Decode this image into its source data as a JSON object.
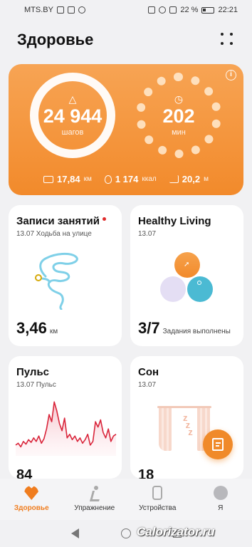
{
  "status_bar": {
    "carrier": "MTS.BY",
    "battery": "22 %",
    "time": "22:21"
  },
  "header": {
    "title": "Здоровье"
  },
  "activity": {
    "steps_value": "24 944",
    "steps_unit": "шагов",
    "minutes_value": "202",
    "minutes_unit": "мин",
    "distance_value": "17,84",
    "distance_unit": "км",
    "calories_value": "1 174",
    "calories_unit": "ккал",
    "floors_value": "20,2",
    "floors_unit": "м"
  },
  "workouts": {
    "title": "Записи занятий",
    "date_line": "13.07  Ходьба на улице",
    "value": "3,46",
    "unit": "км"
  },
  "healthy_living": {
    "title": "Healthy Living",
    "date_line": "13.07",
    "value": "3/7",
    "caption": "Задания выполнены"
  },
  "pulse": {
    "title": "Пульс",
    "date_line": "13.07  Пульс",
    "value_partial": "84",
    "series": [
      62,
      64,
      60,
      66,
      63,
      68,
      65,
      70,
      66,
      72,
      64,
      69,
      80,
      96,
      88,
      110,
      100,
      86,
      78,
      92,
      70,
      74,
      68,
      72,
      66,
      70,
      64,
      68,
      74,
      62,
      66,
      88,
      82,
      90,
      76,
      70,
      80,
      66,
      72,
      74
    ]
  },
  "sleep": {
    "title": "Сон",
    "date_line": "13.07",
    "value_partial": "18"
  },
  "bottom_nav": [
    {
      "label": "Здоровье",
      "active": true,
      "icon": "heart-icon"
    },
    {
      "label": "Упражнение",
      "active": false,
      "icon": "running-icon"
    },
    {
      "label": "Устройства",
      "active": false,
      "icon": "watch-icon"
    },
    {
      "label": "Я",
      "active": false,
      "icon": "profile-icon"
    }
  ],
  "watermark": "Calorizator.ru",
  "colors": {
    "accent": "#f07d1f",
    "pulse_line": "#d9243a",
    "route": "#7fd0e8"
  }
}
